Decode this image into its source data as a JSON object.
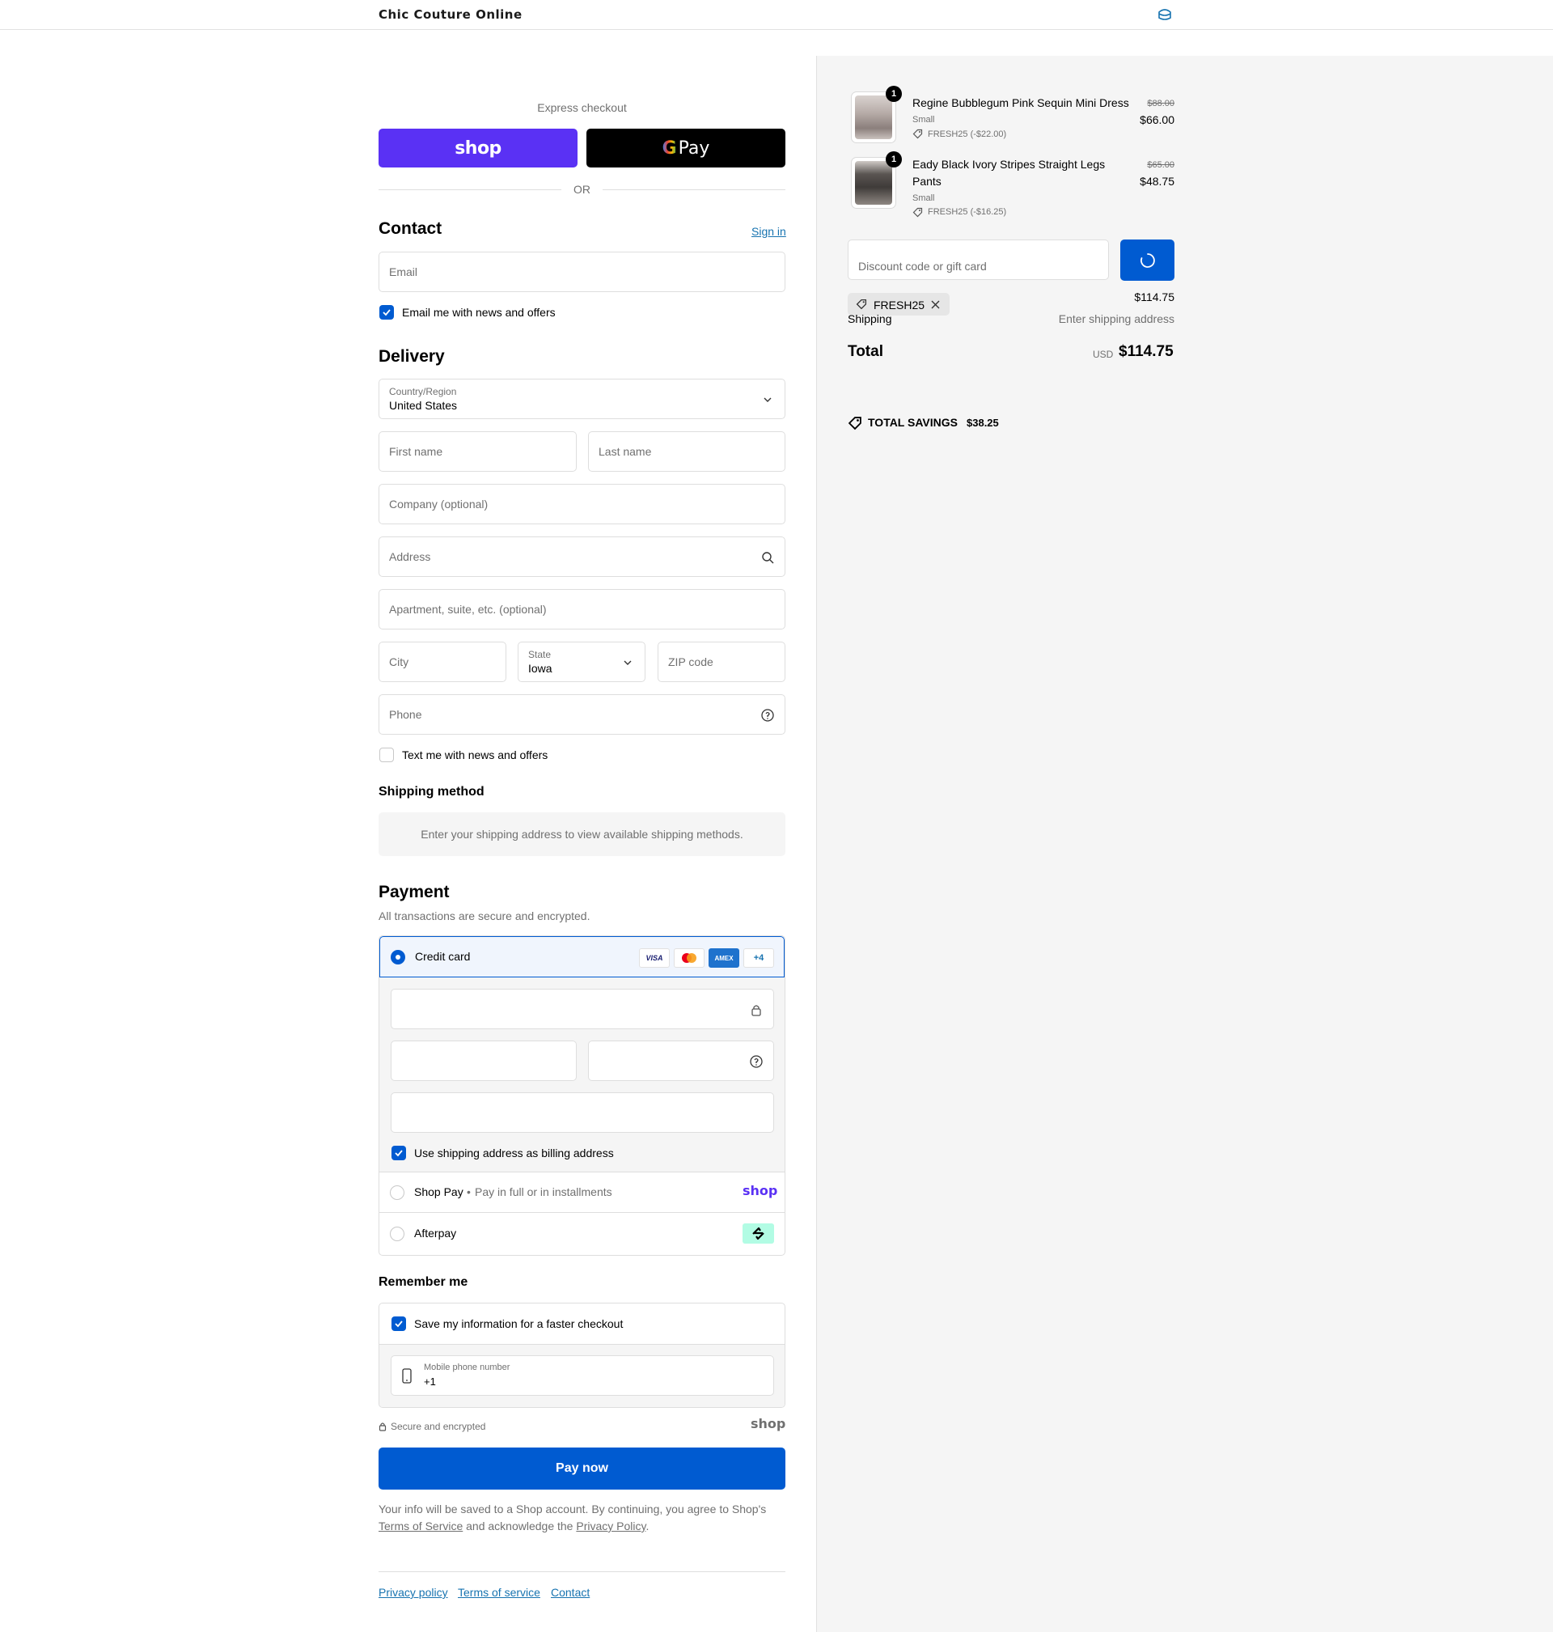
{
  "header": {
    "brand": "Chic Couture Online",
    "cart_icon": "bag-icon"
  },
  "express": {
    "label": "Express checkout",
    "shop_label": "shop",
    "gpay_g": "G",
    "gpay_label": "Pay",
    "or_label": "OR"
  },
  "contact": {
    "title": "Contact",
    "sign_in": "Sign in",
    "email_placeholder": "Email",
    "news_checkbox": "Email me with news and offers",
    "news_checked": true
  },
  "delivery": {
    "title": "Delivery",
    "country_label": "Country/Region",
    "country_value": "United States",
    "first_name": "First name",
    "last_name": "Last name",
    "company": "Company (optional)",
    "address": "Address",
    "apartment": "Apartment, suite, etc. (optional)",
    "city": "City",
    "state_label": "State",
    "state_value": "Iowa",
    "zip": "ZIP code",
    "phone": "Phone",
    "text_checkbox": "Text me with news and offers",
    "text_checked": false
  },
  "shipping_method": {
    "title": "Shipping method",
    "message": "Enter your shipping address to view available shipping methods."
  },
  "payment": {
    "title": "Payment",
    "subtitle": "All transactions are secure and encrypted.",
    "credit_card": "Credit card",
    "card_logos": [
      "VISA",
      "MC",
      "AMEX",
      "+4"
    ],
    "billing_checkbox": "Use shipping address as billing address",
    "shop_pay": "Shop Pay",
    "shop_pay_sep": "•",
    "shop_pay_desc": "Pay in full or in installments",
    "shop_pay_logo": "shop",
    "afterpay": "Afterpay"
  },
  "remember": {
    "title": "Remember me",
    "save_checkbox": "Save my information for a faster checkout",
    "phone_label": "Mobile phone number",
    "phone_value": "+1",
    "secure": "Secure and encrypted",
    "shop_logo": "shop"
  },
  "pay_button": "Pay now",
  "legal": {
    "line1": "Your info will be saved to a Shop account. By continuing, you agree to Shop's",
    "terms": "Terms of Service",
    "mid": "and acknowledge the",
    "privacy": "Privacy Policy",
    "end": "."
  },
  "footer": {
    "privacy": "Privacy policy",
    "terms": "Terms of service",
    "contact": "Contact"
  },
  "summary": {
    "items": [
      {
        "qty": "1",
        "name": "Regine Bubblegum Pink Sequin Mini Dress",
        "variant": "Small",
        "discount": "FRESH25 (-$22.00)",
        "original": "$88.00",
        "price": "$66.00"
      },
      {
        "qty": "1",
        "name_line1": "Eady Black Ivory Stripes Straight Legs",
        "name_line2": "Pants",
        "variant": "Small",
        "discount": "FRESH25 (-$16.25)",
        "original": "$65.00",
        "price": "$48.75"
      }
    ],
    "discount_placeholder": "Discount code or gift card",
    "applied_code": "FRESH25",
    "subtotal_value": "$114.75",
    "shipping_label": "Shipping",
    "shipping_value": "Enter shipping address",
    "total_label": "Total",
    "currency": "USD",
    "total_value": "$114.75",
    "savings_label": "TOTAL SAVINGS",
    "savings_value": "$38.25"
  },
  "colors": {
    "accent": "#005bd1",
    "shop_purple": "#5a31f4",
    "summary_bg": "#f5f5f5",
    "muted": "#707070"
  }
}
